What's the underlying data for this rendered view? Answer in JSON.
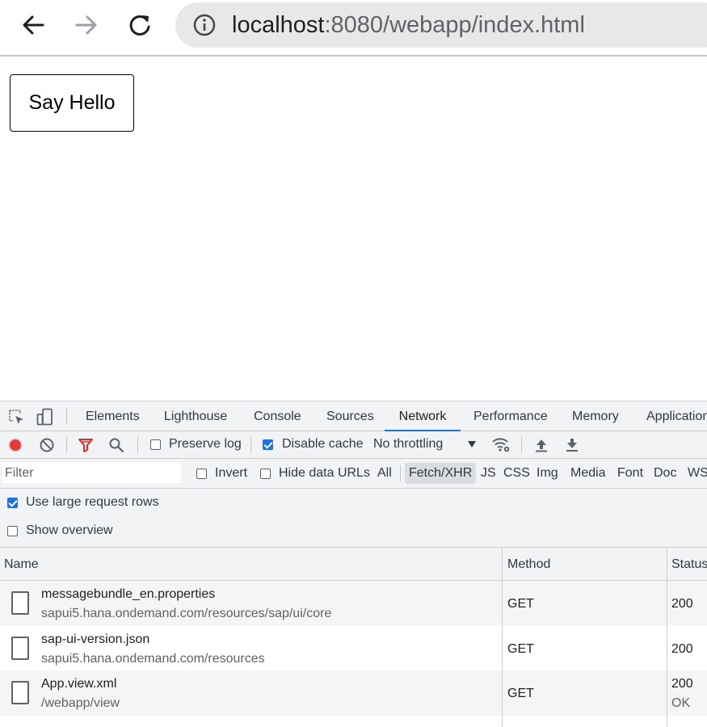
{
  "browser": {
    "url_host": "localhost",
    "url_path": ":8080/webapp/index.html",
    "icons": [
      "back-arrow-icon",
      "forward-arrow-icon",
      "reload-icon",
      "info-icon"
    ]
  },
  "page": {
    "say_hello_label": "Say Hello"
  },
  "devtools": {
    "tabs": [
      "Elements",
      "Lighthouse",
      "Console",
      "Sources",
      "Network",
      "Performance",
      "Memory",
      "Application"
    ],
    "active_tab": "Network",
    "toolbar": {
      "preserve_log_label": "Preserve log",
      "preserve_log_checked": false,
      "disable_cache_label": "Disable cache",
      "disable_cache_checked": true,
      "throttling_value": "No throttling"
    },
    "filter": {
      "placeholder": "Filter",
      "invert_label": "Invert",
      "hide_data_urls_label": "Hide data URLs",
      "types": [
        "All",
        "Fetch/XHR",
        "JS",
        "CSS",
        "Img",
        "Media",
        "Font",
        "Doc",
        "WS"
      ],
      "active_type": "Fetch/XHR"
    },
    "options": {
      "large_rows_label": "Use large request rows",
      "large_rows_checked": true,
      "show_overview_label": "Show overview",
      "show_overview_checked": false
    },
    "table": {
      "columns": [
        "Name",
        "Method",
        "Status"
      ],
      "rows": [
        {
          "name": "messagebundle_en.properties",
          "path": "sapui5.hana.ondemand.com/resources/sap/ui/core",
          "method": "GET",
          "status": "200",
          "status_text": ""
        },
        {
          "name": "sap-ui-version.json",
          "path": "sapui5.hana.ondemand.com/resources",
          "method": "GET",
          "status": "200",
          "status_text": ""
        },
        {
          "name": "App.view.xml",
          "path": "/webapp/view",
          "method": "GET",
          "status": "200",
          "status_text": "OK"
        }
      ]
    },
    "colors": {
      "accent": "#1a73e8",
      "record": "#e53935",
      "filter_funnel": "#d93025"
    }
  }
}
